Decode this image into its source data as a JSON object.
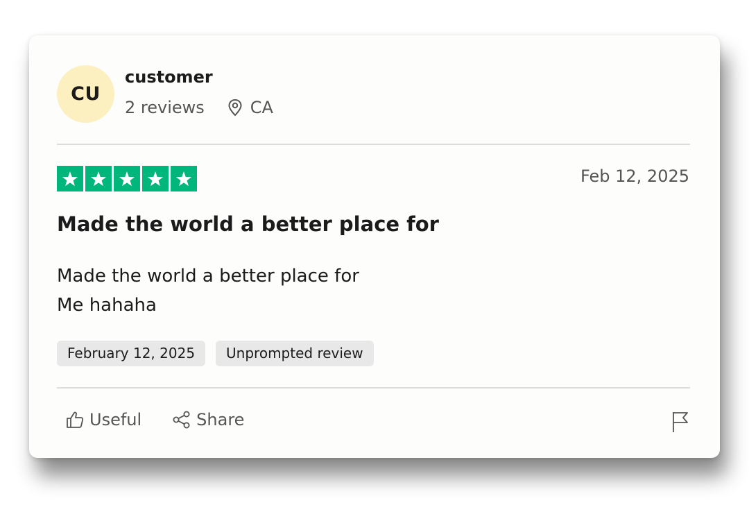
{
  "reviewer": {
    "initials": "CU",
    "name": "customer",
    "review_count": "2 reviews",
    "location": "CA",
    "location_icon": "map-pin-icon"
  },
  "review": {
    "rating": 5,
    "star_color": "#00b67a",
    "date": "Feb 12, 2025",
    "title": "Made the world a better place for",
    "body_lines": [
      "Made the world a better place for",
      "Me hahaha"
    ],
    "tags": [
      "February 12, 2025",
      "Unprompted review"
    ]
  },
  "actions": {
    "useful_label": "Useful",
    "useful_icon": "thumbs-up-icon",
    "share_label": "Share",
    "share_icon": "share-icon",
    "report_icon": "flag-icon"
  },
  "colors": {
    "avatar_bg": "#fcf0c0",
    "text": "#1b1b1b",
    "muted": "#555555"
  }
}
